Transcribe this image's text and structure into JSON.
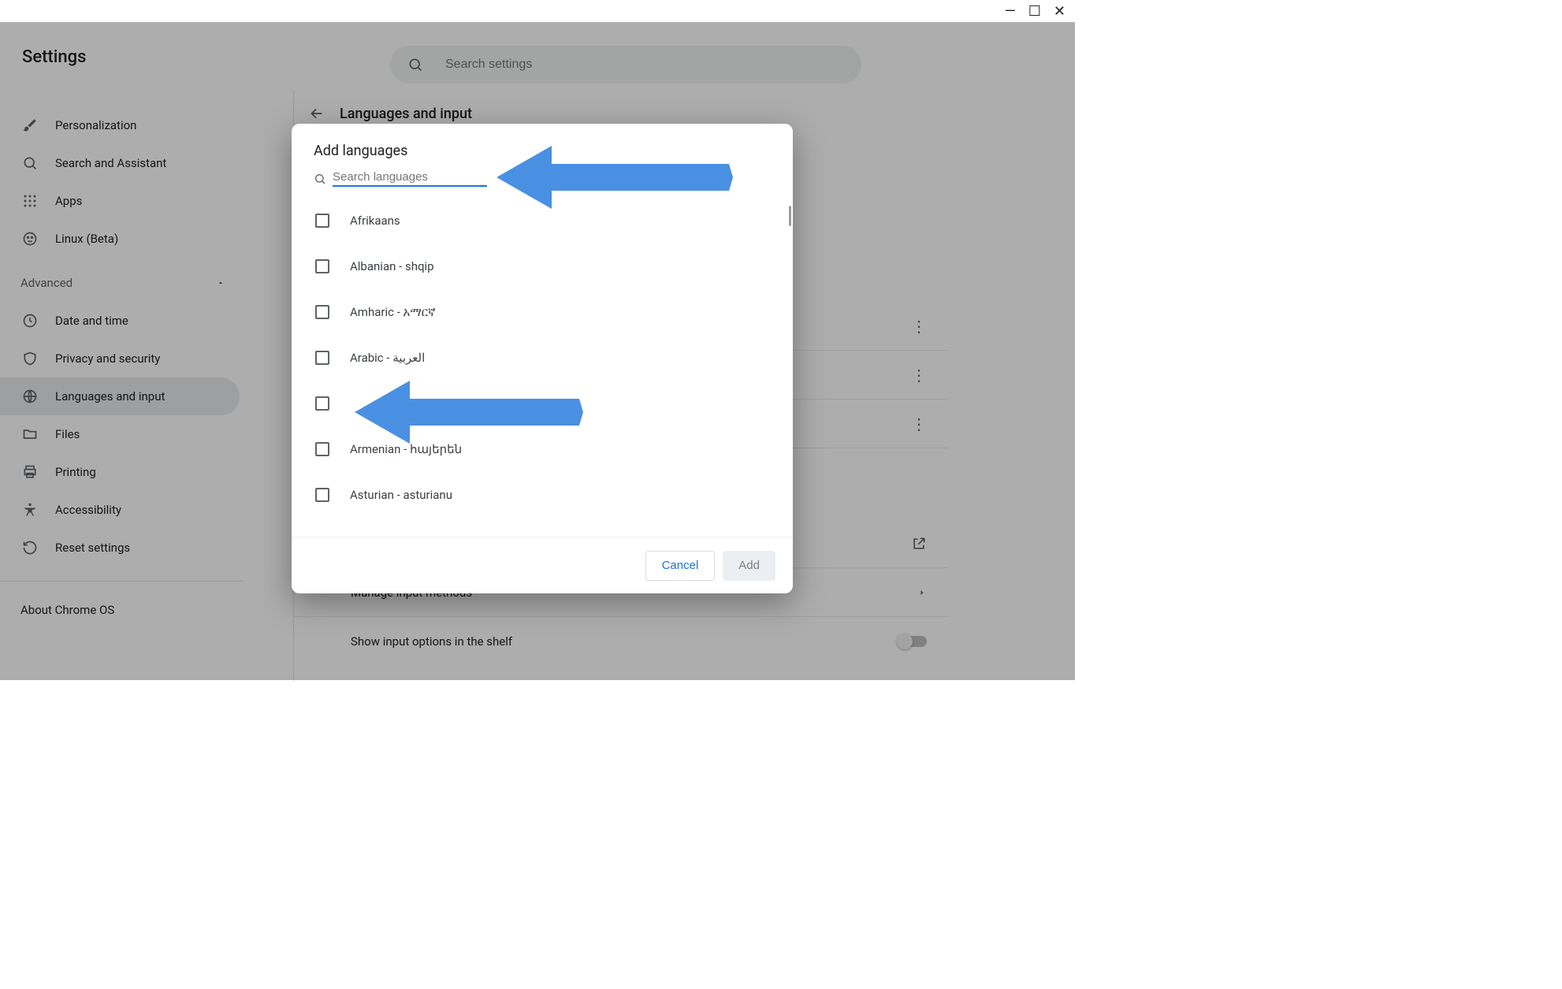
{
  "windowControls": {
    "min": "—",
    "max": "☐",
    "close": "✕"
  },
  "header": {
    "title": "Settings"
  },
  "search": {
    "placeholder": "Search settings"
  },
  "sidebar": {
    "items": [
      {
        "label": "Personalization"
      },
      {
        "label": "Search and Assistant"
      },
      {
        "label": "Apps"
      },
      {
        "label": "Linux (Beta)"
      }
    ],
    "groupLabel": "Advanced",
    "advanced": [
      {
        "label": "Date and time"
      },
      {
        "label": "Privacy and security"
      },
      {
        "label": "Languages and input"
      },
      {
        "label": "Files"
      },
      {
        "label": "Printing"
      },
      {
        "label": "Accessibility"
      },
      {
        "label": "Reset settings"
      }
    ],
    "about": "About Chrome OS"
  },
  "subpage": {
    "title": "Languages and input",
    "rows": {
      "manage_input": "Manage input methods",
      "show_shelf": "Show input options in the shelf"
    }
  },
  "dialog": {
    "title": "Add languages",
    "searchPlaceholder": "Search languages",
    "languages": [
      "Afrikaans",
      "Albanian - shqip",
      "Amharic - አማርኛ",
      "Arabic - العربية",
      "",
      "Armenian - հայերեն",
      "Asturian - asturianu"
    ],
    "cancel": "Cancel",
    "add": "Add"
  }
}
